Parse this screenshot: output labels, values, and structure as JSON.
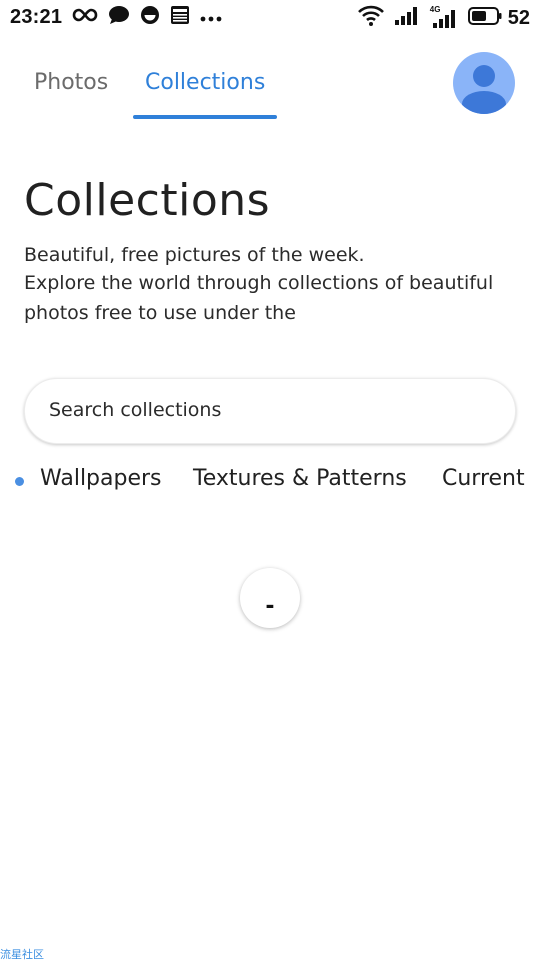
{
  "status_bar": {
    "time": "23:21",
    "battery": "52",
    "network_label": "4G",
    "icons_left": [
      "infinity-icon",
      "chat-bubble-icon",
      "smile-icon",
      "news-icon",
      "more-dots-icon"
    ],
    "icons_right": [
      "wifi-icon",
      "signal-icon",
      "signal-4g-icon",
      "battery-icon"
    ]
  },
  "nav": {
    "tabs": [
      {
        "label": "Photos",
        "active": false
      },
      {
        "label": "Collections",
        "active": true
      }
    ],
    "accent_color": "#2f80d9",
    "avatar_color": "#8ab4f8"
  },
  "main": {
    "title": "Collections",
    "subtitle": "Beautiful, free pictures of the week.",
    "description": "Explore the world through collections of beautiful photos free to use under the"
  },
  "search": {
    "placeholder": "Search collections",
    "value": ""
  },
  "categories": [
    {
      "label": "Wallpapers",
      "selected": true
    },
    {
      "label": "Textures & Patterns",
      "selected": false
    },
    {
      "label": "Current",
      "selected": false
    }
  ],
  "load_more": {
    "label": "-"
  },
  "watermark": "流星社区"
}
